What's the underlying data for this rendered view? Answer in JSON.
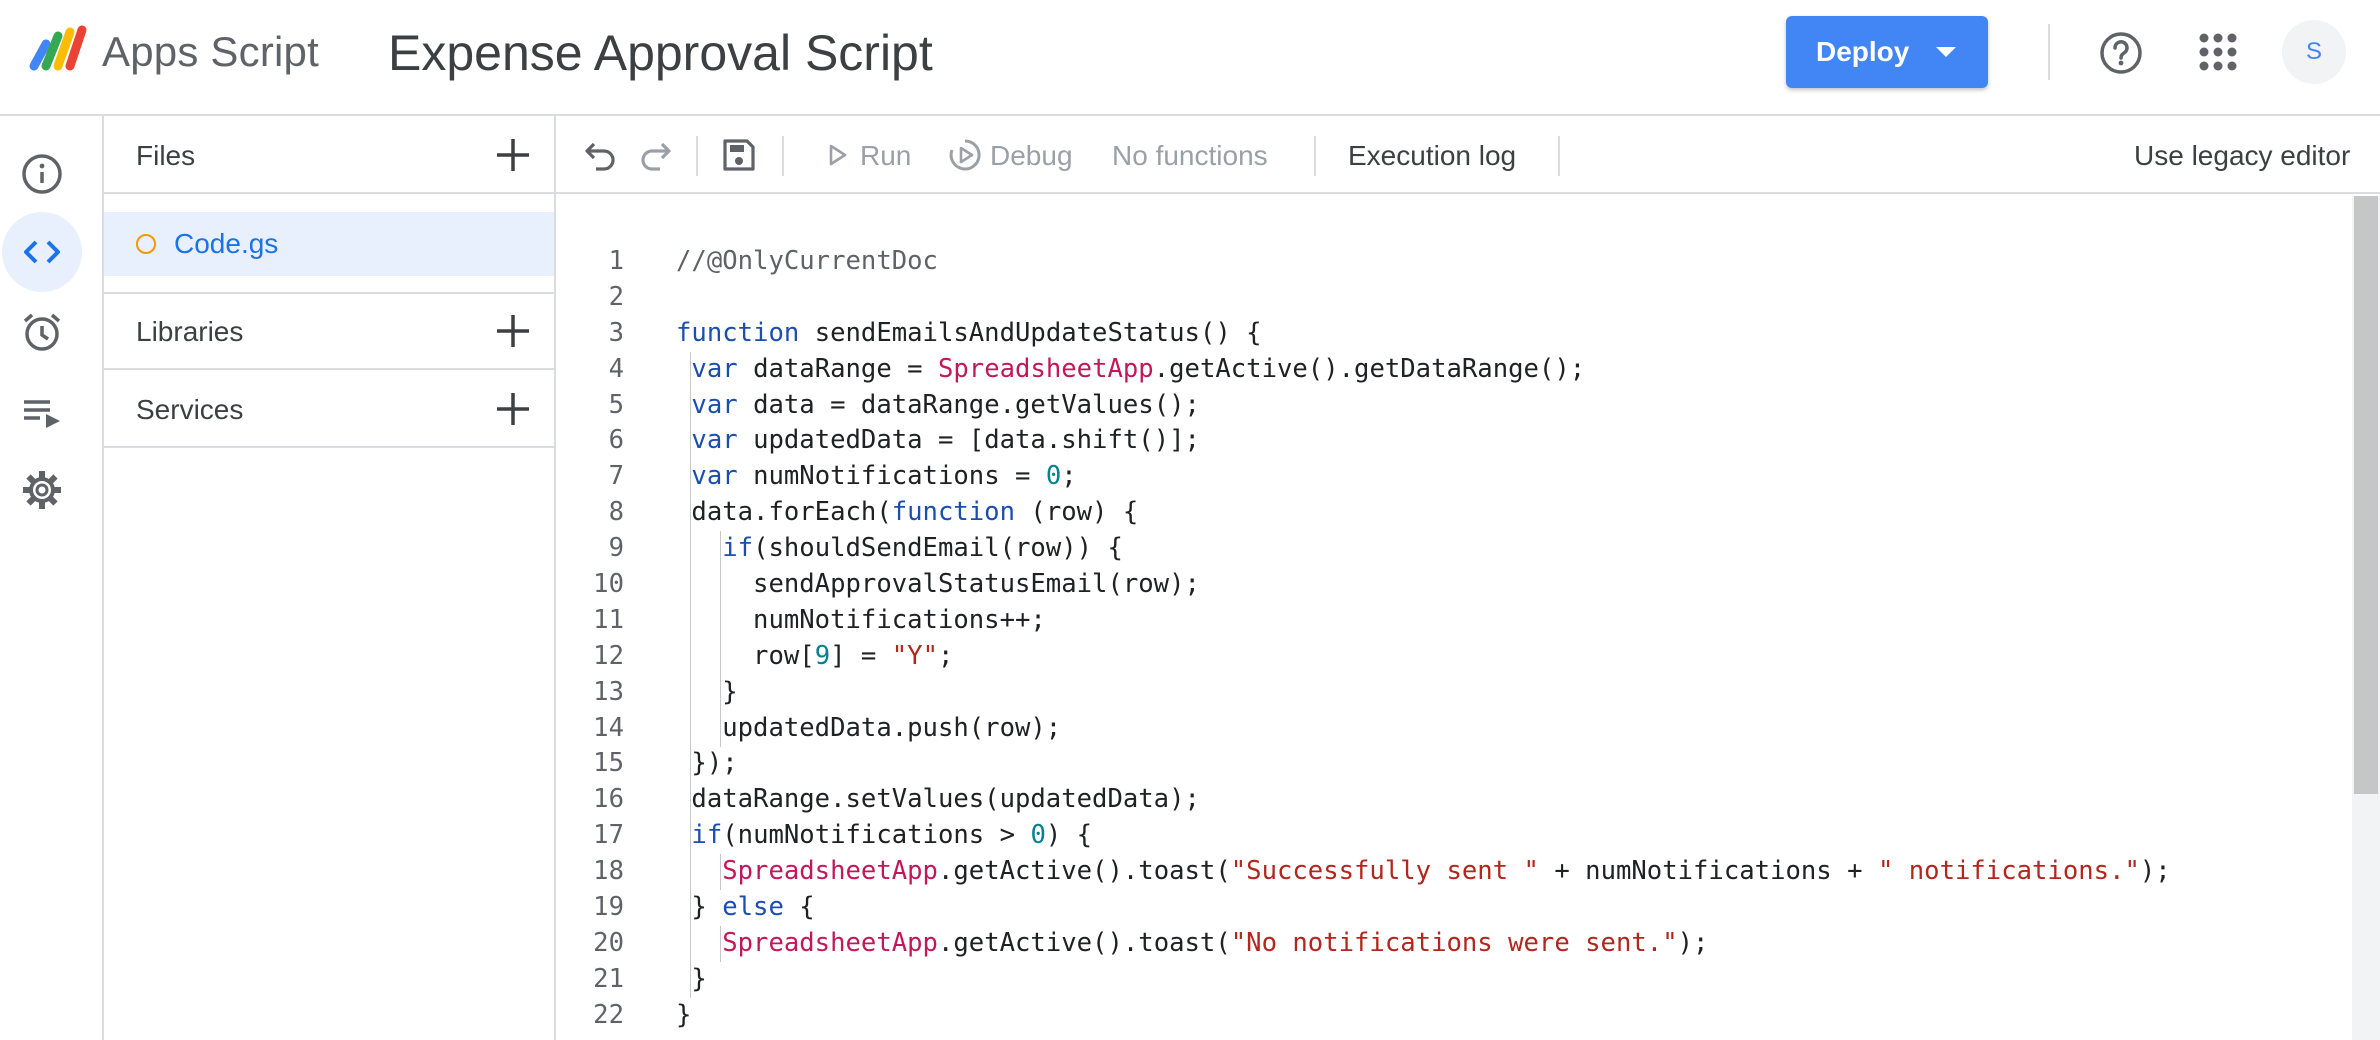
{
  "header": {
    "brand": "Apps Script",
    "project_title": "Expense Approval Script",
    "deploy_label": "Deploy",
    "avatar_initial": "S"
  },
  "icons": {
    "logo": "apps-script-logo",
    "deploy_caret": "caret-down-icon",
    "help": "help-circle-icon",
    "apps": "google-apps-grid-icon",
    "rail": [
      "info-icon",
      "code-icon",
      "alarm-clock-icon",
      "executions-icon",
      "gear-icon"
    ],
    "toolbar": [
      "undo-icon",
      "redo-icon",
      "save-icon",
      "play-icon",
      "debug-icon"
    ]
  },
  "colors": {
    "accent": "#4285f4",
    "selected_bg": "#e8f0fe",
    "file_dot": "#f29900",
    "keyword": "#1a4fb0",
    "class_name": "#c2185b",
    "string": "#b3261e",
    "number": "#00838f"
  },
  "files_panel": {
    "files_label": "Files",
    "active_file": "Code.gs",
    "libraries_label": "Libraries",
    "services_label": "Services"
  },
  "toolbar": {
    "run_label": "Run",
    "debug_label": "Debug",
    "function_select": "No functions",
    "execution_log_label": "Execution log",
    "legacy_editor_label": "Use legacy editor"
  },
  "editor": {
    "file": "Code.gs",
    "lines": [
      {
        "n": "1",
        "tokens": [
          [
            "cmt",
            "//@OnlyCurrentDoc"
          ]
        ]
      },
      {
        "n": "2",
        "tokens": []
      },
      {
        "n": "3",
        "tokens": [
          [
            "kw",
            "function"
          ],
          [
            "",
            " sendEmailsAndUpdateStatus() {"
          ]
        ]
      },
      {
        "n": "4",
        "tokens": [
          [
            "",
            " "
          ],
          [
            "kw",
            "var"
          ],
          [
            "",
            " dataRange = "
          ],
          [
            "cls",
            "SpreadsheetApp"
          ],
          [
            "",
            ".getActive().getDataRange();"
          ]
        ]
      },
      {
        "n": "5",
        "tokens": [
          [
            "",
            " "
          ],
          [
            "kw",
            "var"
          ],
          [
            "",
            " data = dataRange.getValues();"
          ]
        ]
      },
      {
        "n": "6",
        "tokens": [
          [
            "",
            " "
          ],
          [
            "kw",
            "var"
          ],
          [
            "",
            " updatedData = [data.shift()];"
          ]
        ]
      },
      {
        "n": "7",
        "tokens": [
          [
            "",
            " "
          ],
          [
            "kw",
            "var"
          ],
          [
            "",
            " numNotifications = "
          ],
          [
            "num",
            "0"
          ],
          [
            "",
            ";"
          ]
        ]
      },
      {
        "n": "8",
        "tokens": [
          [
            "",
            " data.forEach("
          ],
          [
            "kw",
            "function"
          ],
          [
            "",
            " (row) {"
          ]
        ]
      },
      {
        "n": "9",
        "tokens": [
          [
            "",
            "   "
          ],
          [
            "kw",
            "if"
          ],
          [
            "",
            "(shouldSendEmail(row)) {"
          ]
        ]
      },
      {
        "n": "10",
        "tokens": [
          [
            "",
            "     sendApprovalStatusEmail(row);"
          ]
        ]
      },
      {
        "n": "11",
        "tokens": [
          [
            "",
            "     numNotifications++;"
          ]
        ]
      },
      {
        "n": "12",
        "tokens": [
          [
            "",
            "     row["
          ],
          [
            "num",
            "9"
          ],
          [
            "",
            "] = "
          ],
          [
            "str",
            "\"Y\""
          ],
          [
            "",
            ";"
          ]
        ]
      },
      {
        "n": "13",
        "tokens": [
          [
            "",
            "   }"
          ]
        ]
      },
      {
        "n": "14",
        "tokens": [
          [
            "",
            "   updatedData.push(row);"
          ]
        ]
      },
      {
        "n": "15",
        "tokens": [
          [
            "",
            " });"
          ]
        ]
      },
      {
        "n": "16",
        "tokens": [
          [
            "",
            " dataRange.setValues(updatedData);"
          ]
        ]
      },
      {
        "n": "17",
        "tokens": [
          [
            "",
            " "
          ],
          [
            "kw",
            "if"
          ],
          [
            "",
            "(numNotifications > "
          ],
          [
            "num",
            "0"
          ],
          [
            "",
            ") {"
          ]
        ]
      },
      {
        "n": "18",
        "tokens": [
          [
            "",
            "   "
          ],
          [
            "cls",
            "SpreadsheetApp"
          ],
          [
            "",
            ".getActive().toast("
          ],
          [
            "str",
            "\"Successfully sent \""
          ],
          [
            "",
            " + numNotifications + "
          ],
          [
            "str",
            "\" notifications.\""
          ],
          [
            "",
            ");"
          ]
        ]
      },
      {
        "n": "19",
        "tokens": [
          [
            "",
            " } "
          ],
          [
            "kw",
            "else"
          ],
          [
            "",
            " {"
          ]
        ]
      },
      {
        "n": "20",
        "tokens": [
          [
            "",
            "   "
          ],
          [
            "cls",
            "SpreadsheetApp"
          ],
          [
            "",
            ".getActive().toast("
          ],
          [
            "str",
            "\"No notifications were sent.\""
          ],
          [
            "",
            ");"
          ]
        ]
      },
      {
        "n": "21",
        "tokens": [
          [
            "",
            " }"
          ]
        ]
      },
      {
        "n": "22",
        "tokens": [
          [
            "",
            "}"
          ]
        ]
      }
    ]
  }
}
